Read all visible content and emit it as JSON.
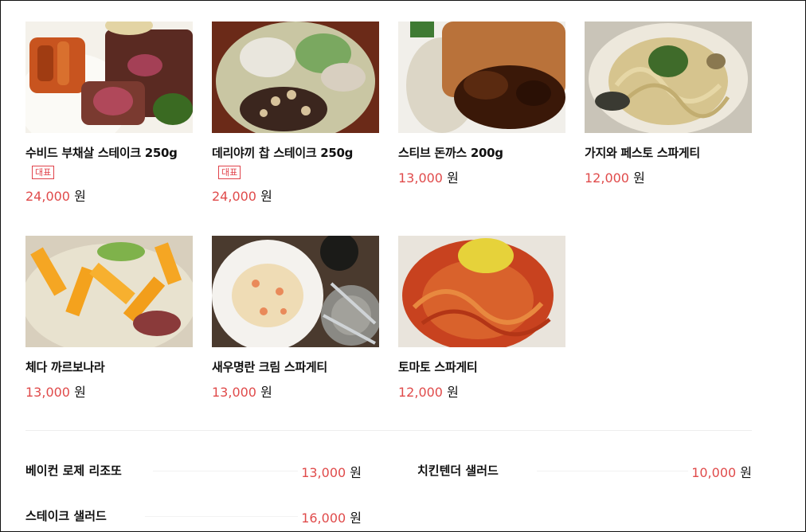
{
  "menu": {
    "currency": "원",
    "cards": [
      {
        "name": "수비드 부채살 스테이크 250g",
        "badge": "대표",
        "price": "24,000",
        "image": "steak-plate"
      },
      {
        "name": "데리야끼 찹 스테이크 250g",
        "badge": "대표",
        "price": "24,000",
        "image": "chop-steak-plate"
      },
      {
        "name": "스티브 돈까스 200g",
        "badge": "",
        "price": "13,000",
        "image": "pork-cutlet-plate"
      },
      {
        "name": "가지와 페스토 스파게티",
        "badge": "",
        "price": "12,000",
        "image": "pesto-pasta-plate"
      },
      {
        "name": "체다 까르보나라",
        "badge": "",
        "price": "13,000",
        "image": "carbonara-plate"
      },
      {
        "name": "새우명란 크림 스파게티",
        "badge": "",
        "price": "13,000",
        "image": "shrimp-cream-pasta-plate"
      },
      {
        "name": "토마토 스파게티",
        "badge": "",
        "price": "12,000",
        "image": "tomato-pasta-plate"
      }
    ],
    "list": [
      {
        "name": "베이컨 로제 리조또",
        "price": "13,000"
      },
      {
        "name": "치킨텐더 샐러드",
        "price": "10,000"
      },
      {
        "name": "스테이크 샐러드",
        "price": "16,000"
      }
    ]
  }
}
